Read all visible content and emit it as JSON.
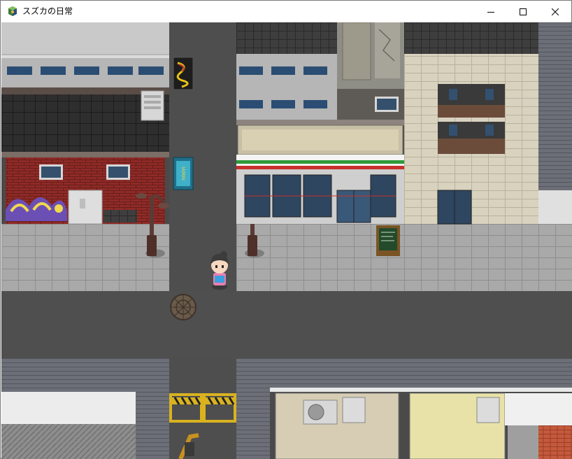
{
  "window": {
    "title": "スズカの日常",
    "icon": "rpg-maker-app-icon",
    "controls": [
      "minimize-icon",
      "maximize-icon",
      "close-icon"
    ]
  },
  "scene": {
    "type": "top-down town map",
    "player": "girl-character-sprite",
    "signs": {
      "neon_dragon": "dragon-neon-sign",
      "vertical_sign": "IAMAI",
      "chalkboard": "menu-chalkboard-sign"
    },
    "colors": {
      "road": "#4a4a4a",
      "sidewalk": "#a9a9a9",
      "brick": "#8e2b27",
      "store_stripe_green": "#2f9a3a",
      "store_stripe_red": "#c9302c"
    }
  }
}
